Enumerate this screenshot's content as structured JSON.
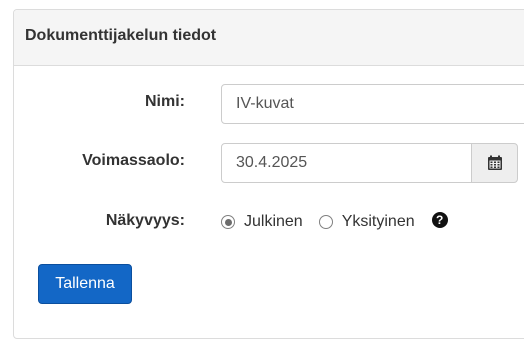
{
  "panel": {
    "title": "Dokumenttijakelun tiedot"
  },
  "form": {
    "name": {
      "label": "Nimi:",
      "value": "IV-kuvat"
    },
    "validity": {
      "label": "Voimassaolo:",
      "value": "30.4.2025",
      "icon": "calendar-icon"
    },
    "visibility": {
      "label": "Näkyvyys:",
      "options": [
        {
          "label": "Julkinen",
          "selected": true
        },
        {
          "label": "Yksityinen",
          "selected": false
        }
      ],
      "help_icon": "question-circle-icon"
    },
    "save_label": "Tallenna"
  },
  "colors": {
    "accent": "#1367c6",
    "header_bg": "#f5f5f5",
    "border": "#dcdcdc"
  }
}
